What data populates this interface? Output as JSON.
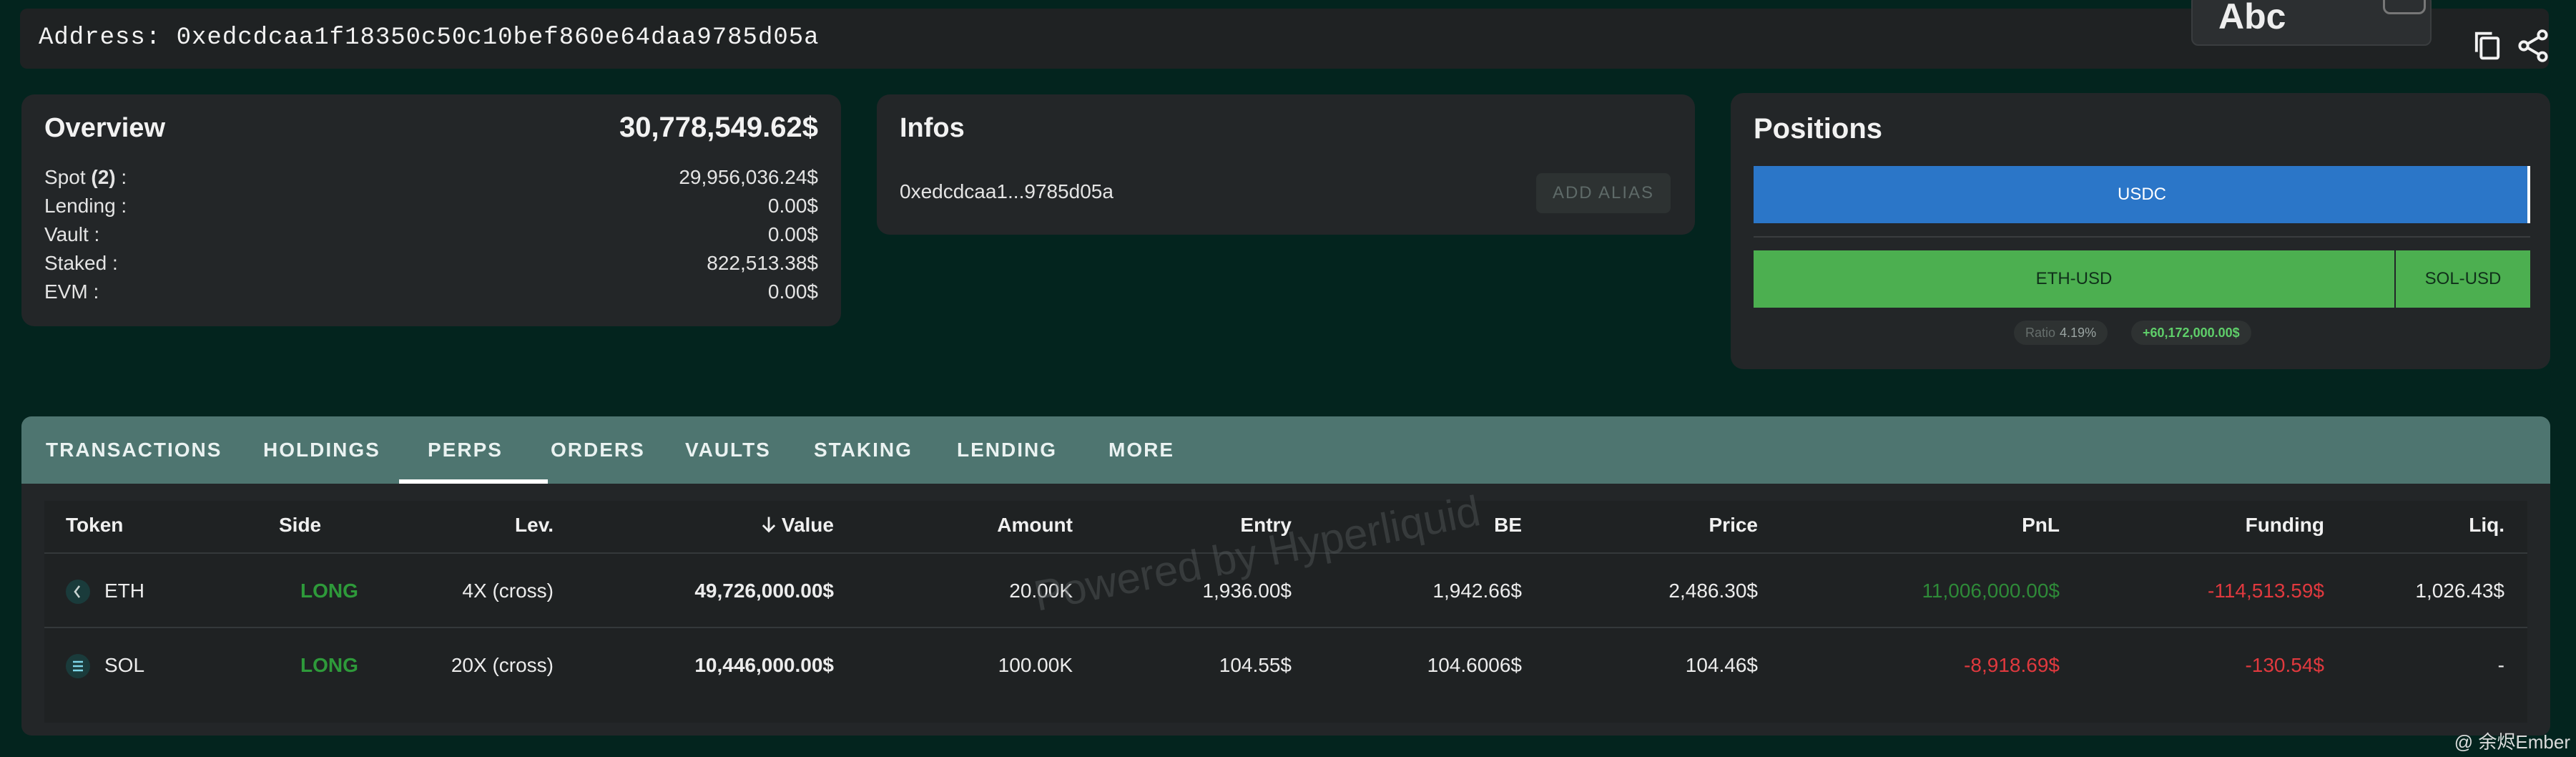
{
  "address_bar": {
    "text": "Address: 0xedcdcaa1f18350c50c10bef860e64daa9785d05a",
    "overlay_text": "Abc"
  },
  "overview": {
    "title": "Overview",
    "total": "30,778,549.62$",
    "spot_label_prefix": "Spot ",
    "spot_count": "(2)",
    "spot_label_suffix": " :",
    "spot_value": "29,956,036.24$",
    "rows": [
      {
        "label": "Lending :",
        "value": "0.00$"
      },
      {
        "label": "Vault :",
        "value": "0.00$"
      },
      {
        "label": "Staked :",
        "value": "822,513.38$"
      },
      {
        "label": "EVM :",
        "value": "0.00$"
      }
    ]
  },
  "infos": {
    "title": "Infos",
    "short_address": "0xedcdcaa1...9785d05a",
    "add_alias_label": "ADD ALIAS"
  },
  "positions": {
    "title": "Positions",
    "usdc_label": "USDC",
    "eth_label": "ETH-USD",
    "sol_label": "SOL-USD",
    "ratio_label": "Ratio",
    "ratio_value": "4.19%",
    "pnl_value": "+60,172,000.00$",
    "colors": {
      "usdc": "#2b76c8",
      "perp": "#4caf50"
    }
  },
  "tabs": [
    {
      "label": "TRANSACTIONS"
    },
    {
      "label": "HOLDINGS"
    },
    {
      "label": "PERPS"
    },
    {
      "label": "ORDERS"
    },
    {
      "label": "VAULTS"
    },
    {
      "label": "STAKING"
    },
    {
      "label": "LENDING"
    },
    {
      "label": "MORE"
    }
  ],
  "active_tab": "PERPS",
  "table": {
    "headers": {
      "token": "Token",
      "side": "Side",
      "lev": "Lev.",
      "value": "Value",
      "amount": "Amount",
      "entry": "Entry",
      "be": "BE",
      "price": "Price",
      "pnl": "PnL",
      "funding": "Funding",
      "liq": "Liq."
    },
    "sort_icon": "arrow-down-icon",
    "rows": [
      {
        "token": "ETH",
        "side": "LONG",
        "lev": "4X (cross)",
        "value": "49,726,000.00$",
        "amount": "20.00K",
        "entry": "1,936.00$",
        "be": "1,942.66$",
        "price": "2,486.30$",
        "pnl": "11,006,000.00$",
        "funding": "-114,513.59$",
        "liq": "1,026.43$"
      },
      {
        "token": "SOL",
        "side": "LONG",
        "lev": "20X (cross)",
        "value": "10,446,000.00$",
        "amount": "100.00K",
        "entry": "104.55$",
        "be": "104.6006$",
        "price": "104.46$",
        "pnl": "-8,918.69$",
        "funding": "-130.54$",
        "liq": "-"
      }
    ]
  },
  "watermark": "Powered by Hyperliquid",
  "credit": "@ 余烬Ember"
}
